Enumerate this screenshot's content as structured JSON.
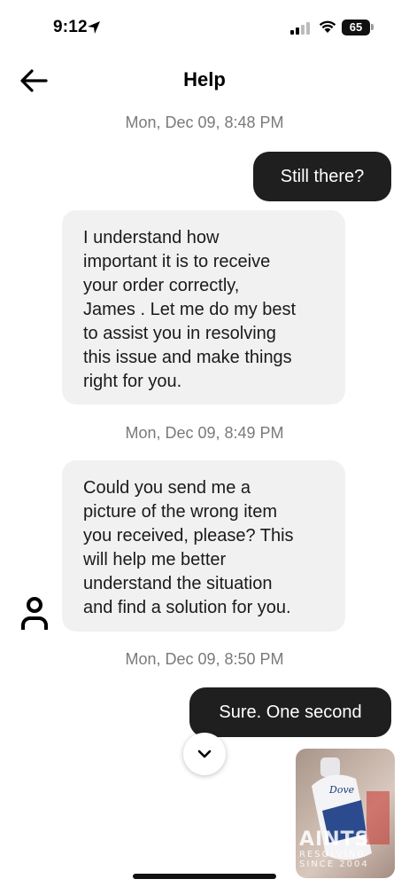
{
  "status_bar": {
    "time": "9:12",
    "battery": "65"
  },
  "header": {
    "title": "Help"
  },
  "messages": [
    {
      "type": "timestamp",
      "text": "Mon, Dec 09, 8:48 PM"
    },
    {
      "type": "outgoing",
      "text": "Still there?"
    },
    {
      "type": "incoming",
      "lines": [
        "I understand how",
        "important it is to receive",
        "your order correctly,",
        "James . Let me do my best",
        "to assist you in resolving",
        "this issue and make things",
        "right for you."
      ]
    },
    {
      "type": "timestamp",
      "text": "Mon, Dec 09, 8:49 PM"
    },
    {
      "type": "incoming",
      "lines": [
        "Could you send me a",
        "picture of the wrong item",
        "you received, please? This",
        "will help me better",
        "understand the situation",
        "and find a solution for you."
      ]
    },
    {
      "type": "timestamp",
      "text": "Mon, Dec 09, 8:50 PM"
    },
    {
      "type": "outgoing",
      "text": "Sure. One second"
    }
  ],
  "attachment": {
    "product_text": "Dove",
    "watermark": {
      "big": "AINTS",
      "line1": "RESOLVING",
      "line2": "SINCE 2004"
    }
  },
  "icons": {
    "back": "arrow-left-icon",
    "avatar": "person-icon",
    "scroll": "chevron-down-icon",
    "location": "location-arrow-icon"
  }
}
